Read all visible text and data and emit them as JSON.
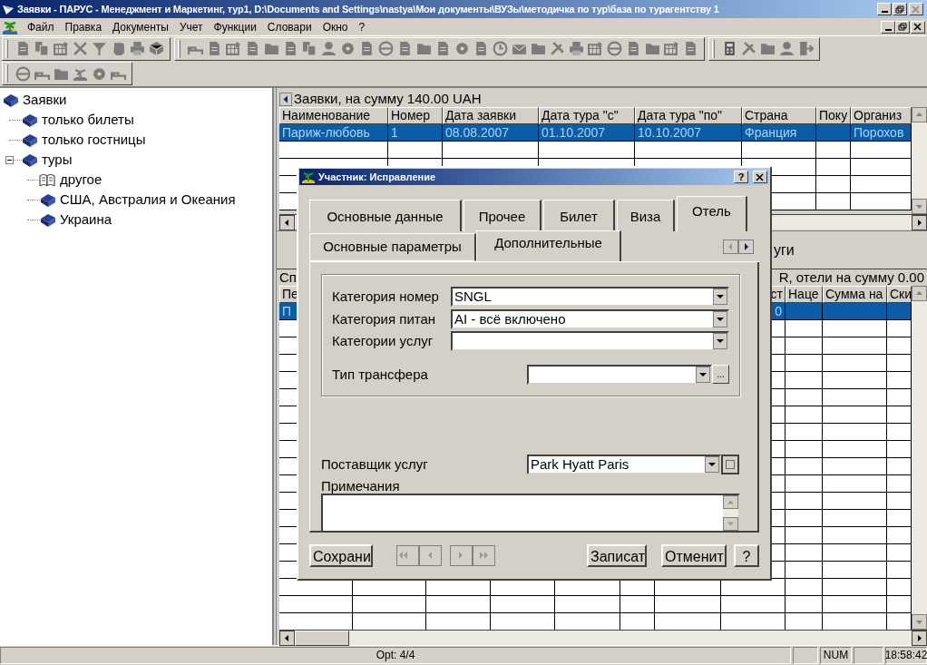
{
  "window": {
    "title": "Заявки - ПАРУС - Менеджмент и Маркетинг, тур1, D:\\Documents and Settings\\nastya\\Мои документы\\ВУЗы\\методичка по тур\\база по турагентству 1"
  },
  "menu": [
    {
      "label": "Файл"
    },
    {
      "label": "Правка"
    },
    {
      "label": "Документы"
    },
    {
      "label": "Учет"
    },
    {
      "label": "Функции"
    },
    {
      "label": "Словари"
    },
    {
      "label": "Окно"
    },
    {
      "label": "?"
    }
  ],
  "tree": [
    {
      "label": "Заявки",
      "kind": "book",
      "children": [
        {
          "label": "только билеты",
          "kind": "book"
        },
        {
          "label": "только гостницы",
          "kind": "book"
        },
        {
          "label": "туры",
          "kind": "book",
          "expanded": true,
          "children": [
            {
              "label": "другое",
              "kind": "open_book"
            },
            {
              "label": "США, Австралия и Океания",
              "kind": "book"
            },
            {
              "label": "Украина",
              "kind": "book"
            }
          ]
        }
      ]
    }
  ],
  "top_grid": {
    "caption": "Заявки, на сумму 140.00 UAH",
    "columns": [
      "Наименование",
      "Номер",
      "Дата заявки",
      "Дата тура \"с\"",
      "Дата тура \"по\"",
      "Страна",
      "Поку",
      "Организ"
    ],
    "rows": [
      {
        "selected": true,
        "cells": [
          "Париж-любовь",
          "1",
          "08.08.2007",
          "01.10.2007",
          "10.10.2007",
          "Франция",
          "",
          "Порохов"
        ]
      }
    ]
  },
  "lower_pane": {
    "title_fragment": "уги",
    "caption_left": "Сп",
    "caption_right": "R, отели на сумму 0.00",
    "first_column": "Пе",
    "right_columns": [
      "ст",
      "Наце",
      "Сумма на",
      "Ски"
    ],
    "rows": [
      {
        "selected": true,
        "first_cell": "П",
        "right_cells": [
          "0",
          "",
          "",
          ""
        ]
      }
    ]
  },
  "dialog": {
    "title": "Участник: Исправление",
    "tabs": [
      {
        "label": "Основные данные",
        "selected": false
      },
      {
        "label": "Прочее",
        "selected": false
      },
      {
        "label": "Билет",
        "selected": false
      },
      {
        "label": "Виза",
        "selected": false
      },
      {
        "label": "Отель",
        "selected": true
      }
    ],
    "subtabs": [
      {
        "label": "Основные параметры",
        "selected": false
      },
      {
        "label": "Дополнительные",
        "selected": true
      }
    ],
    "group_fields": [
      {
        "label": "Категория номер",
        "value": "SNGL",
        "kind": "combo"
      },
      {
        "label": "Категория питан",
        "value": "AI - всё включено",
        "kind": "combo"
      },
      {
        "label": "Категории услуг",
        "kind": "combo"
      },
      {
        "label": "Тип трансфера",
        "kind": "combo_ellipsis",
        "button": "..."
      }
    ],
    "supplier": {
      "label": "Поставщик услуг",
      "value": "Park Hyatt Paris"
    },
    "notes": {
      "label": "Примечания"
    },
    "buttons": [
      {
        "label": "Сохрани",
        "kind": "text"
      },
      {
        "kind": "nav",
        "disabled": true
      },
      {
        "label": "Записат",
        "kind": "text"
      },
      {
        "label": "Отменит",
        "kind": "text"
      },
      {
        "label": "?",
        "kind": "text"
      }
    ],
    "help_button": "?"
  },
  "status_bar": {
    "message": "Opt: 4/4",
    "num": "NUM",
    "clock": "18:58:42"
  }
}
